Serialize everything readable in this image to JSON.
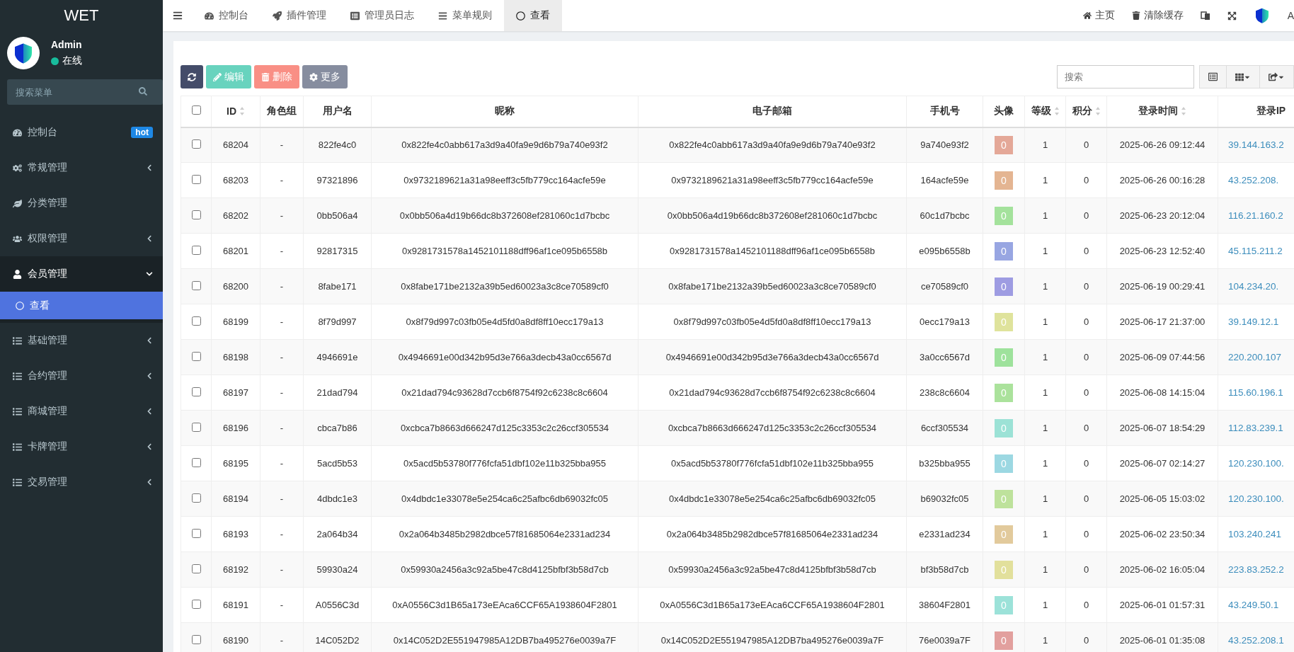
{
  "sidebar": {
    "logo": "WET",
    "user": {
      "name": "Admin",
      "status": "在线"
    },
    "search": {
      "placeholder": "搜索菜单"
    },
    "items": [
      {
        "label": "控制台",
        "kind": "link",
        "badge": "hot",
        "selected": false
      },
      {
        "label": "常规管理",
        "kind": "group",
        "expanded": false,
        "selected": false
      },
      {
        "label": "分类管理",
        "kind": "link",
        "selected": false
      },
      {
        "label": "权限管理",
        "kind": "group",
        "expanded": false,
        "selected": false
      },
      {
        "label": "会员管理",
        "kind": "group",
        "expanded": true,
        "selected": false,
        "children": [
          {
            "label": "查看",
            "selected": true
          }
        ]
      },
      {
        "label": "基础管理",
        "kind": "group",
        "expanded": false,
        "selected": false
      },
      {
        "label": "合约管理",
        "kind": "group",
        "expanded": false,
        "selected": false
      },
      {
        "label": "商城管理",
        "kind": "group",
        "expanded": false,
        "selected": false
      },
      {
        "label": "卡牌管理",
        "kind": "group",
        "expanded": false,
        "selected": false
      },
      {
        "label": "交易管理",
        "kind": "group",
        "expanded": false,
        "selected": false
      }
    ]
  },
  "tabs": [
    {
      "label": "控制台",
      "selected": false
    },
    {
      "label": "插件管理",
      "selected": false
    },
    {
      "label": "管理员日志",
      "selected": false
    },
    {
      "label": "菜单规则",
      "selected": false
    },
    {
      "label": "查看",
      "selected": true
    }
  ],
  "header_links": [
    {
      "label": "主页"
    },
    {
      "label": "清除缓存"
    }
  ],
  "header_user": "A",
  "toolbar": {
    "buttons": [
      {
        "kind": "refresh",
        "disabled": false
      },
      {
        "kind": "edit",
        "label": "编辑",
        "disabled": true
      },
      {
        "kind": "delete",
        "label": "删除",
        "disabled": true
      },
      {
        "kind": "more",
        "label": "更多",
        "disabled": false
      }
    ],
    "search": {
      "placeholder": "搜索"
    }
  },
  "table": {
    "all_checked": false,
    "columns": [
      {
        "label": "ID",
        "sortable": true
      },
      {
        "label": "角色组",
        "sortable": false
      },
      {
        "label": "用户名",
        "sortable": false
      },
      {
        "label": "昵称",
        "sortable": false
      },
      {
        "label": "电子邮箱",
        "sortable": false
      },
      {
        "label": "手机号",
        "sortable": false
      },
      {
        "label": "头像",
        "sortable": false
      },
      {
        "label": "等级",
        "sortable": true
      },
      {
        "label": "积分",
        "sortable": true
      },
      {
        "label": "登录时间",
        "sortable": true
      },
      {
        "label": "登录IP",
        "sortable": false
      }
    ],
    "rows": [
      {
        "checked": false,
        "cells": [
          "68204",
          "-",
          "822fe4c0",
          "0x822fe4c0abb617a3d9a40fa9e9d6b79a740e93f2",
          "0x822fe4c0abb617a3d9a40fa9e9d6b79a740e93f2",
          "9a740e93f2"
        ],
        "avatar": {
          "text": "0",
          "color": "#e4a898"
        },
        "level": "1",
        "score": "0",
        "login_time": "2025-06-26 09:12:44",
        "login_ip": "39.144.163.2"
      },
      {
        "checked": false,
        "cells": [
          "68203",
          "-",
          "97321896",
          "0x9732189621a31a98eeff3c5fb779cc164acfe59e",
          "0x9732189621a31a98eeff3c5fb779cc164acfe59e",
          "164acfe59e"
        ],
        "avatar": {
          "text": "0",
          "color": "#e4b592"
        },
        "level": "1",
        "score": "0",
        "login_time": "2025-06-26 00:16:28",
        "login_ip": "43.252.208."
      },
      {
        "checked": false,
        "cells": [
          "68202",
          "-",
          "0bb506a4",
          "0x0bb506a4d19b66dc8b372608ef281060c1d7bcbc",
          "0x0bb506a4d19b66dc8b372608ef281060c1d7bcbc",
          "60c1d7bcbc"
        ],
        "avatar": {
          "text": "0",
          "color": "#a4e29c"
        },
        "level": "1",
        "score": "0",
        "login_time": "2025-06-23 20:12:04",
        "login_ip": "116.21.160.2"
      },
      {
        "checked": false,
        "cells": [
          "68201",
          "-",
          "92817315",
          "0x9281731578a1452101188dff96af1ce095b6558b",
          "0x9281731578a1452101188dff96af1ce095b6558b",
          "e095b6558b"
        ],
        "avatar": {
          "text": "0",
          "color": "#98a6e2"
        },
        "level": "1",
        "score": "0",
        "login_time": "2025-06-23 12:52:40",
        "login_ip": "45.115.211.2"
      },
      {
        "checked": false,
        "cells": [
          "68200",
          "-",
          "8fabe171",
          "0x8fabe171be2132a39b5ed60023a3c8ce70589cf0",
          "0x8fabe171be2132a39b5ed60023a3c8ce70589cf0",
          "ce70589cf0"
        ],
        "avatar": {
          "text": "0",
          "color": "#9e9ce2"
        },
        "level": "1",
        "score": "0",
        "login_time": "2025-06-19 00:29:41",
        "login_ip": "104.234.20."
      },
      {
        "checked": false,
        "cells": [
          "68199",
          "-",
          "8f79d997",
          "0x8f79d997c03fb05e4d5fd0a8df8ff10ecc179a13",
          "0x8f79d997c03fb05e4d5fd0a8df8ff10ecc179a13",
          "0ecc179a13"
        ],
        "avatar": {
          "text": "0",
          "color": "#dfe39c"
        },
        "level": "1",
        "score": "0",
        "login_time": "2025-06-17 21:37:00",
        "login_ip": "39.149.12.1"
      },
      {
        "checked": false,
        "cells": [
          "68198",
          "-",
          "4946691e",
          "0x4946691e00d342b95d3e766a3decb43a0cc6567d",
          "0x4946691e00d342b95d3e766a3decb43a0cc6567d",
          "3a0cc6567d"
        ],
        "avatar": {
          "text": "0",
          "color": "#9ee29c"
        },
        "level": "1",
        "score": "0",
        "login_time": "2025-06-09 07:44:56",
        "login_ip": "220.200.107"
      },
      {
        "checked": false,
        "cells": [
          "68197",
          "-",
          "21dad794",
          "0x21dad794c93628d7ccb6f8754f92c6238c8c6604",
          "0x21dad794c93628d7ccb6f8754f92c6238c8c6604",
          "238c8c6604"
        ],
        "avatar": {
          "text": "0",
          "color": "#abe29c"
        },
        "level": "1",
        "score": "0",
        "login_time": "2025-06-08 14:15:04",
        "login_ip": "115.60.196.1"
      },
      {
        "checked": false,
        "cells": [
          "68196",
          "-",
          "cbca7b86",
          "0xcbca7b8663d666247d125c3353c2c26ccf305534",
          "0xcbca7b8663d666247d125c3353c2c26ccf305534",
          "6ccf305534"
        ],
        "avatar": {
          "text": "0",
          "color": "#9ce2d6"
        },
        "level": "1",
        "score": "0",
        "login_time": "2025-06-07 18:54:29",
        "login_ip": "112.83.239.1"
      },
      {
        "checked": false,
        "cells": [
          "68195",
          "-",
          "5acd5b53",
          "0x5acd5b53780f776fcfa51dbf102e11b325bba955",
          "0x5acd5b53780f776fcfa51dbf102e11b325bba955",
          "b325bba955"
        ],
        "avatar": {
          "text": "0",
          "color": "#9cd8e2"
        },
        "level": "1",
        "score": "0",
        "login_time": "2025-06-07 02:14:27",
        "login_ip": "120.230.100."
      },
      {
        "checked": false,
        "cells": [
          "68194",
          "-",
          "4dbdc1e3",
          "0x4dbdc1e33078e5e254ca6c25afbc6db69032fc05",
          "0x4dbdc1e33078e5e254ca6c25afbc6db69032fc05",
          "b69032fc05"
        ],
        "avatar": {
          "text": "0",
          "color": "#bee29c"
        },
        "level": "1",
        "score": "0",
        "login_time": "2025-06-05 15:03:02",
        "login_ip": "120.230.100."
      },
      {
        "checked": false,
        "cells": [
          "68193",
          "-",
          "2a064b34",
          "0x2a064b3485b2982dbce57f81685064e2331ad234",
          "0x2a064b3485b2982dbce57f81685064e2331ad234",
          "e2331ad234"
        ],
        "avatar": {
          "text": "0",
          "color": "#e2ca9c"
        },
        "level": "1",
        "score": "0",
        "login_time": "2025-06-02 23:50:34",
        "login_ip": "103.240.241"
      },
      {
        "checked": false,
        "cells": [
          "68192",
          "-",
          "59930a24",
          "0x59930a2456a3c92a5be47c8d4125bfbf3b58d7cb",
          "0x59930a2456a3c92a5be47c8d4125bfbf3b58d7cb",
          "bf3b58d7cb"
        ],
        "avatar": {
          "text": "0",
          "color": "#e2e09c"
        },
        "level": "1",
        "score": "0",
        "login_time": "2025-06-02 16:05:04",
        "login_ip": "223.83.252.2"
      },
      {
        "checked": false,
        "cells": [
          "68191",
          "-",
          "A0556C3d",
          "0xA0556C3d1B65a173eEAca6CCF65A1938604F2801",
          "0xA0556C3d1B65a173eEAca6CCF65A1938604F2801",
          "38604F2801"
        ],
        "avatar": {
          "text": "0",
          "color": "#9ce2d9"
        },
        "level": "1",
        "score": "0",
        "login_time": "2025-06-01 01:57:31",
        "login_ip": "43.249.50.1"
      },
      {
        "checked": false,
        "cells": [
          "68190",
          "-",
          "14C052D2",
          "0x14C052D2E551947985A12DB7ba495276e0039a7F",
          "0x14C052D2E551947985A12DB7ba495276e0039a7F",
          "76e0039a7F"
        ],
        "avatar": {
          "text": "0",
          "color": "#e2a09e"
        },
        "level": "1",
        "score": "0",
        "login_time": "2025-06-01 01:35:08",
        "login_ip": "43.252.208.1"
      }
    ]
  }
}
